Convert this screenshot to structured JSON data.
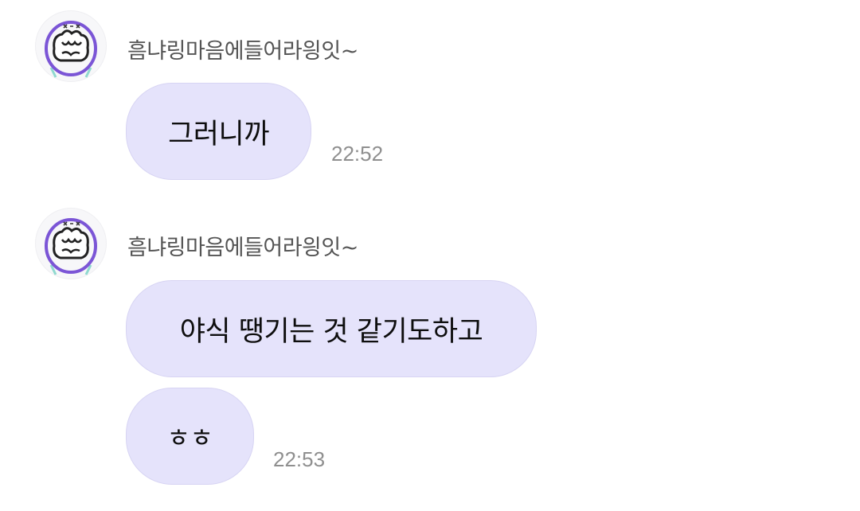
{
  "messages": [
    {
      "sender": "흠냐링마음에들어라읭잇~",
      "avatar_icon": "doodle-face-icon",
      "bubbles": [
        {
          "text": "그러니까"
        }
      ],
      "time": "22:52"
    },
    {
      "sender": "흠냐링마음에들어라읭잇~",
      "avatar_icon": "doodle-face-icon",
      "bubbles": [
        {
          "text": "야식 땡기는 것 같기도하고"
        },
        {
          "text": "ㅎㅎ"
        }
      ],
      "time": "22:53"
    }
  ],
  "colors": {
    "bubble": "#e5e3fb",
    "avatar_outline": "#7b55d6",
    "time": "#8f8f8f"
  }
}
